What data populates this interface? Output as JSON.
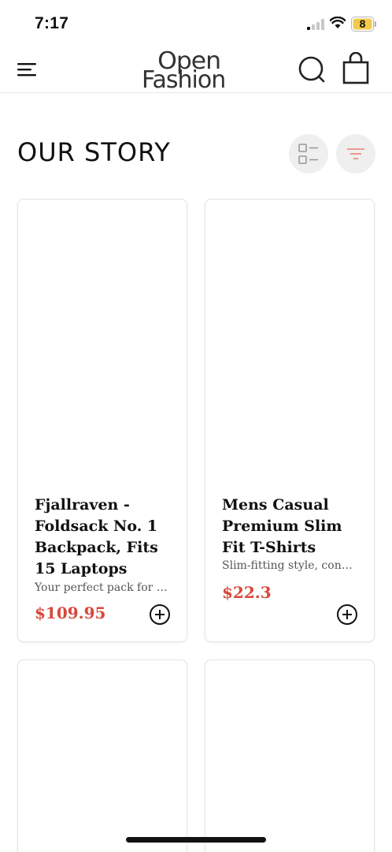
{
  "status_bar": {
    "time": "7:17",
    "battery_level": "8",
    "icons": [
      "signal-icon",
      "wifi-icon",
      "battery-icon"
    ]
  },
  "header": {
    "logo_line1": "Open",
    "logo_line2": "Fashion",
    "icons": [
      "menu-icon",
      "search-icon",
      "shopping-bag-icon"
    ]
  },
  "section": {
    "title": "OUR STORY",
    "icons": [
      "list-view-icon",
      "filter-icon"
    ]
  },
  "colors": {
    "price": "#d9473a",
    "filter_accent": "#e8826a",
    "card_border": "#e4e4e4",
    "button_bg": "#efefef"
  },
  "products": [
    {
      "title": "Fjallraven - Foldsack No. 1 Backpack, Fits 15 Laptops",
      "description": "Your perfect pack for everyday use and walks in the forest",
      "price": "$109.95"
    },
    {
      "title": "Mens Casual Premium Slim Fit T-Shirts",
      "description": "Slim-fitting style, contrast raglan long sleeve",
      "price": "$22.3"
    }
  ]
}
